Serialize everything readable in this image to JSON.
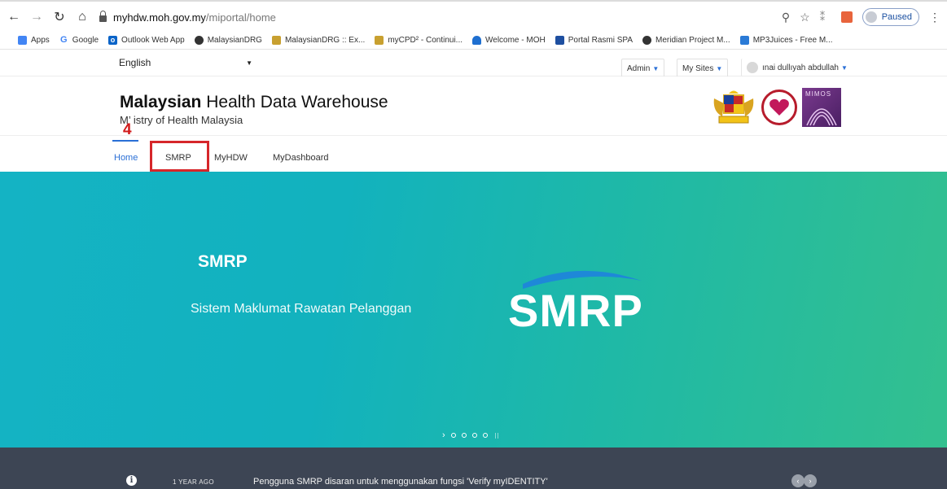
{
  "browser": {
    "url_host": "myhdw.moh.gov.my",
    "url_path": "/miportal/home",
    "paused_label": "Paused"
  },
  "bookmarks": [
    {
      "label": "Apps",
      "icon": "apps-grid-icon",
      "color": "#4285f4"
    },
    {
      "label": "Google",
      "icon": "google-icon",
      "color": "#4285f4"
    },
    {
      "label": "Outlook Web App",
      "icon": "outlook-icon",
      "color": "#0a64c8"
    },
    {
      "label": "MalaysianDRG",
      "icon": "globe-icon",
      "color": "#333333"
    },
    {
      "label": "MalaysianDRG :: Ex...",
      "icon": "crest-icon",
      "color": "#c8a030"
    },
    {
      "label": "myCPD² - Continui...",
      "icon": "crest-icon",
      "color": "#c8a030"
    },
    {
      "label": "Welcome - MOH",
      "icon": "shield-icon",
      "color": "#1e6fd0"
    },
    {
      "label": "Portal Rasmi SPA",
      "icon": "spa-icon",
      "color": "#1e4fa0"
    },
    {
      "label": "Meridian Project M...",
      "icon": "globe-icon",
      "color": "#333333"
    },
    {
      "label": "MP3Juices - Free M...",
      "icon": "music-icon",
      "color": "#2a7ad6"
    }
  ],
  "site_top": {
    "language": "English",
    "admin": "Admin",
    "my_sites": "My Sites",
    "user": "ınai dullıyah abdullah"
  },
  "header": {
    "title_bold": "Malaysian",
    "title_rest": " Health Data Warehouse",
    "subtitle": "M’ istry of Health Malaysia",
    "mimos": "MIMOS"
  },
  "nav": {
    "items": [
      "Home",
      "SMRP",
      "MyHDW",
      "MyDashboard"
    ]
  },
  "annotation": {
    "step": "4"
  },
  "hero": {
    "title": "SMRP",
    "subtitle": "Sistem Maklumat Rawatan Pelanggan",
    "logo": "SMRP",
    "next_arrow": "›"
  },
  "ticker": {
    "time": "1 YEAR AGO",
    "text": "Pengguna SMRP disaran untuk menggunakan fungsi 'Verify myIDENTITY'",
    "prev": "‹",
    "next": "›"
  },
  "colors": {
    "accent_blue": "#2a6fd6",
    "annotation_red": "#d6262a",
    "ticker_bg": "#3d4554"
  }
}
